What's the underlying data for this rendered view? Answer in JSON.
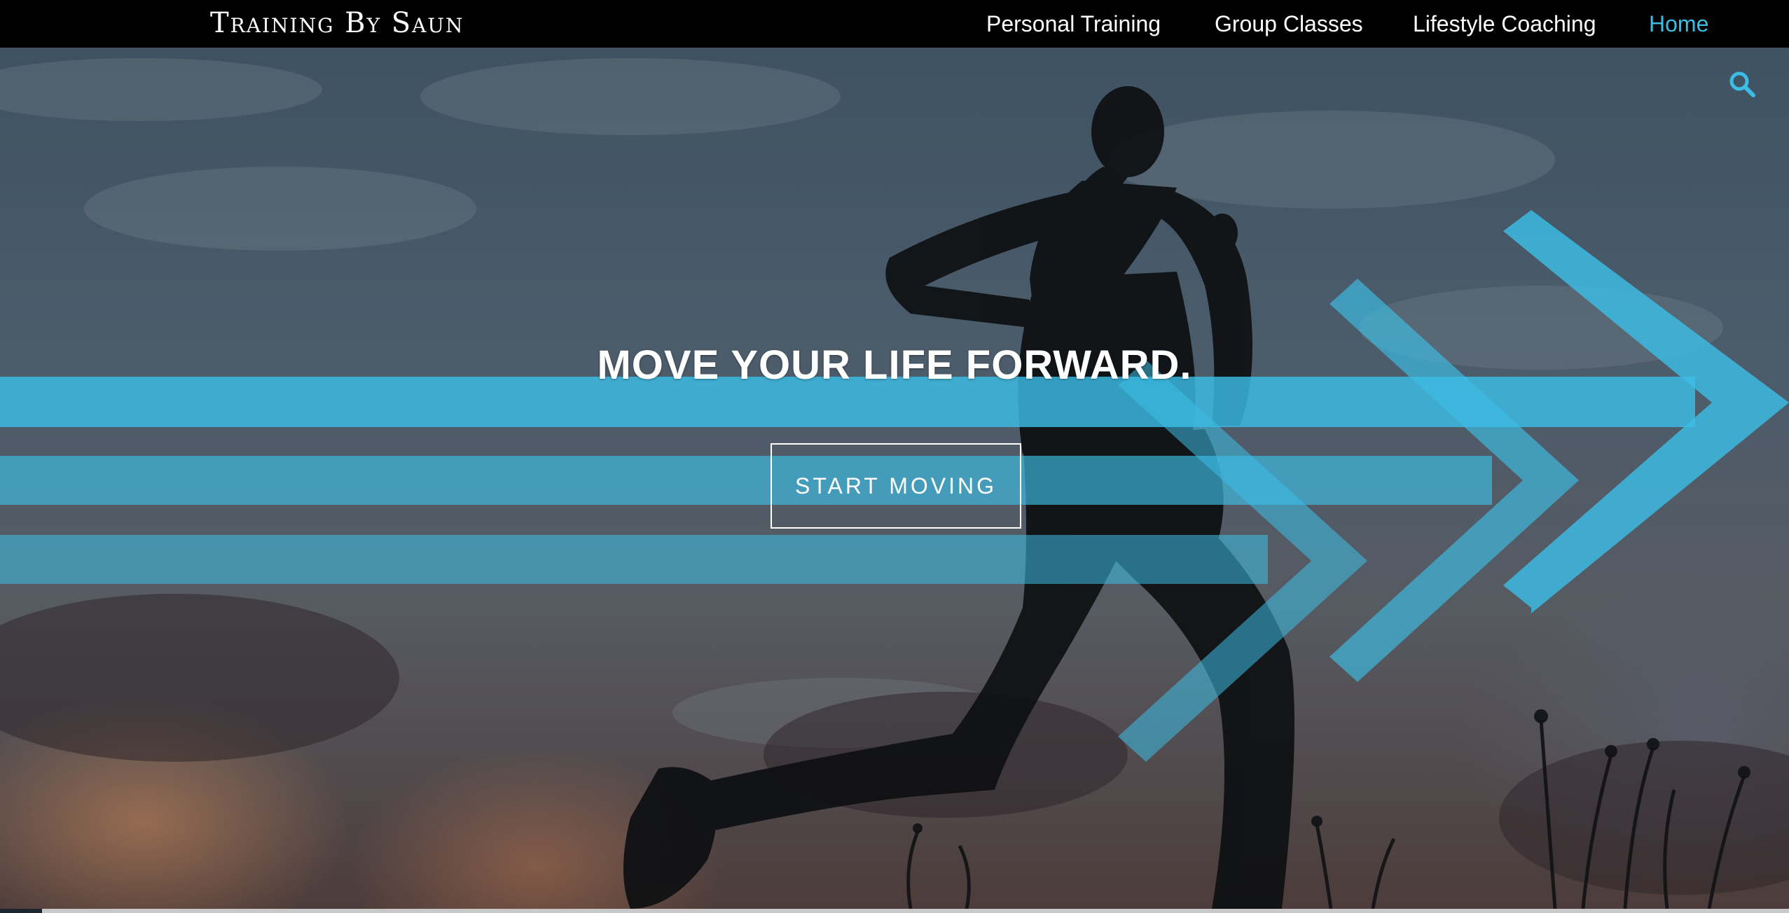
{
  "header": {
    "brand": "Training By Saun",
    "nav": [
      {
        "label": "Personal Training"
      },
      {
        "label": "Group Classes"
      },
      {
        "label": "Lifestyle Coaching"
      },
      {
        "label": "Home",
        "active": true
      }
    ]
  },
  "hero": {
    "headline": "MOVE YOUR LIFE FORWARD.",
    "cta_label": "START MOVING"
  },
  "icons": {
    "search": "search-icon"
  },
  "colors": {
    "accent": "#3cbde5",
    "nav_background": "#000000",
    "text": "#ffffff"
  }
}
